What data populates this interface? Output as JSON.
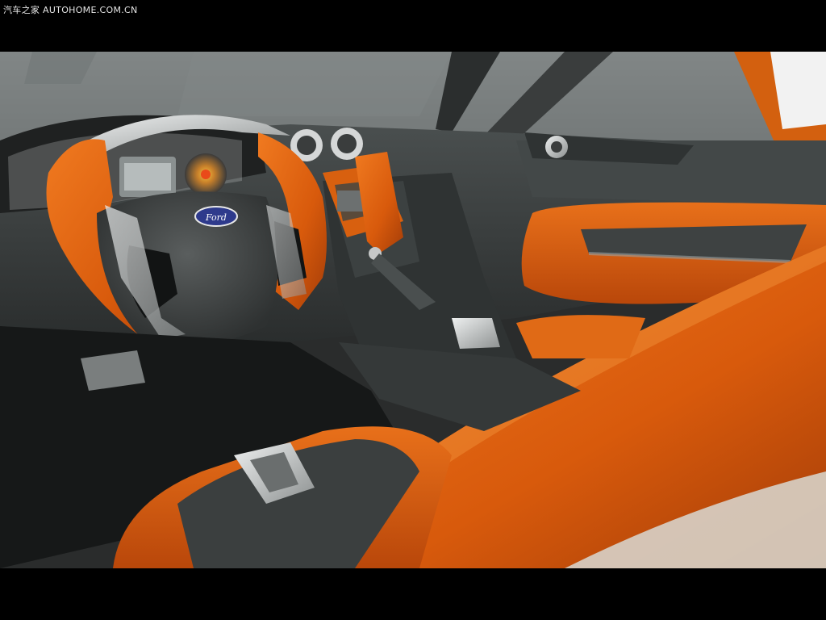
{
  "watermark": {
    "text": "汽车之家  AUTOHOME.COM.CN"
  },
  "photo": {
    "subject": "ford-concept-car-interior",
    "badge_text": "Ford",
    "colors": {
      "orange": "#e0620f",
      "orange_dark": "#a9410a",
      "charcoal": "#3b3f3f",
      "dark": "#1c1e1e",
      "silver": "#c9cbcb",
      "badge_blue": "#2e3a8c"
    }
  }
}
